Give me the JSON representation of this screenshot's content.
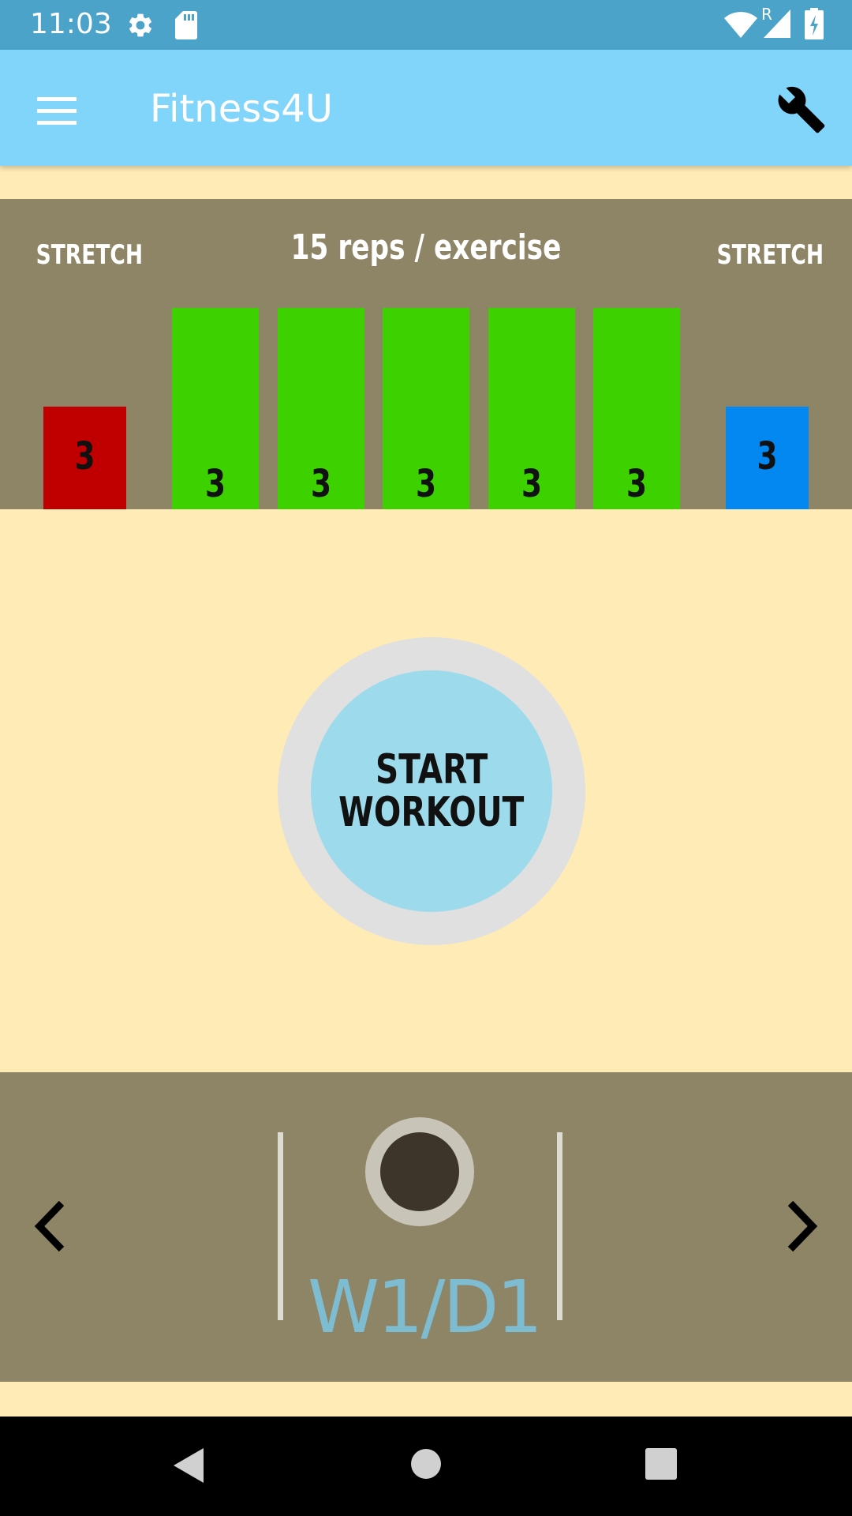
{
  "status_bar": {
    "time": "11:03",
    "network_label": "R"
  },
  "app_bar": {
    "title": "Fitness4U"
  },
  "workout": {
    "reps_label": "15 reps / exercise",
    "stretch_start_label": "STRETCH",
    "stretch_end_label": "STRETCH",
    "warmup": {
      "value": "3",
      "color": "#C00000"
    },
    "exercises": [
      {
        "value": "3",
        "color": "#3ED100"
      },
      {
        "value": "3",
        "color": "#3ED100"
      },
      {
        "value": "3",
        "color": "#3ED100"
      },
      {
        "value": "3",
        "color": "#3ED100"
      },
      {
        "value": "3",
        "color": "#3ED100"
      }
    ],
    "cooldown": {
      "value": "3",
      "color": "#0288F0"
    }
  },
  "start_button": {
    "line1": "START",
    "line2": "WORKOUT"
  },
  "day_selector": {
    "label": "W1/D1"
  },
  "colors": {
    "status_bar": "#4BA3C9",
    "app_bar": "#81D4FA",
    "background": "#FFEBB5",
    "panel": "#8E8466",
    "start_button": "#9DDAEC",
    "day_label": "#7EBCD2"
  },
  "icons": {
    "status": [
      "gear-icon",
      "sd-card-icon",
      "wifi-icon",
      "cell-signal-icon",
      "battery-charging-icon"
    ],
    "app_bar": [
      "menu-icon",
      "wrench-icon"
    ],
    "navigation": [
      "back-triangle-icon",
      "home-circle-icon",
      "recents-square-icon"
    ]
  }
}
